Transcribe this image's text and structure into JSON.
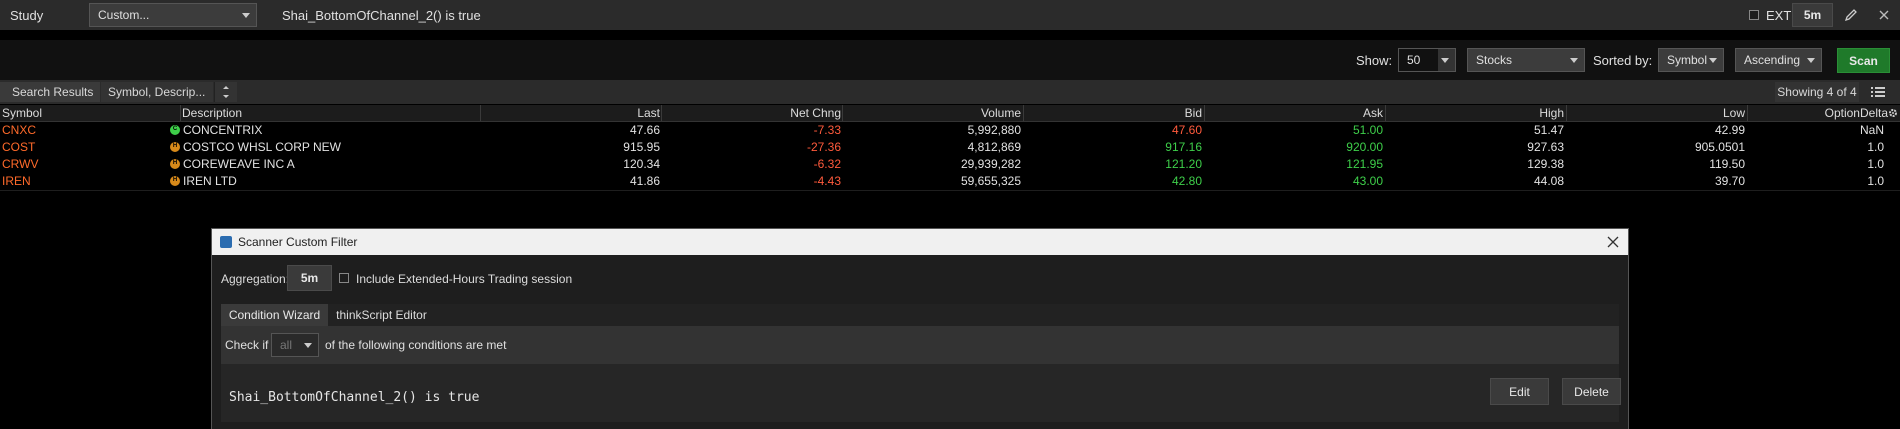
{
  "topbar": {
    "study_label": "Study",
    "study_select": "Custom...",
    "study_condition": "Shai_BottomOfChannel_2() is true",
    "ext_label": "EXT",
    "aggregation": "5m"
  },
  "controls": {
    "show_label": "Show:",
    "show_value": "50",
    "list_value": "Stocks",
    "sorted_label": "Sorted by:",
    "sort_field": "Symbol",
    "sort_order": "Ascending",
    "scan_label": "Scan"
  },
  "results": {
    "tab_label": "Search Results",
    "columns_selector": "Symbol, Descrip...",
    "showing_text": "Showing 4 of 4"
  },
  "table": {
    "headers": [
      "Symbol",
      "Description",
      "Last",
      "Net Chng",
      "Volume",
      "Bid",
      "Ask",
      "High",
      "Low",
      "OptionDelta"
    ],
    "rows": [
      {
        "symbol": "CNXC",
        "badge": "C",
        "description": "CONCENTRIX",
        "last": "47.66",
        "net_chng": "-7.33",
        "volume": "5,992,880",
        "bid": "47.60",
        "ask": "51.00",
        "high": "51.47",
        "low": "42.99",
        "delta": "NaN",
        "bid_color": "red",
        "ask_color": "grn"
      },
      {
        "symbol": "COST",
        "badge": "H",
        "description": "COSTCO WHSL CORP NEW",
        "last": "915.95",
        "net_chng": "-27.36",
        "volume": "4,812,869",
        "bid": "917.16",
        "ask": "920.00",
        "high": "927.63",
        "low": "905.0501",
        "delta": "1.0",
        "bid_color": "grn",
        "ask_color": "grn"
      },
      {
        "symbol": "CRWV",
        "badge": "H",
        "description": "COREWEAVE INC A",
        "last": "120.34",
        "net_chng": "-6.32",
        "volume": "29,939,282",
        "bid": "121.20",
        "ask": "121.95",
        "high": "129.38",
        "low": "119.50",
        "delta": "1.0",
        "bid_color": "grn",
        "ask_color": "grn"
      },
      {
        "symbol": "IREN",
        "badge": "H",
        "description": "IREN LTD",
        "last": "41.86",
        "net_chng": "-4.43",
        "volume": "59,655,325",
        "bid": "42.80",
        "ask": "43.00",
        "high": "44.08",
        "low": "39.70",
        "delta": "1.0",
        "bid_color": "grn",
        "ask_color": "grn"
      }
    ]
  },
  "dialog": {
    "title": "Scanner Custom Filter",
    "aggregation_label": "Aggregation:",
    "aggregation_value": "5m",
    "extended_hours_label": "Include Extended-Hours Trading session",
    "tabs": [
      "Condition Wizard",
      "thinkScript Editor"
    ],
    "check_if_label": "Check if",
    "match_value": "all",
    "conditions_suffix": "of the following conditions are met",
    "condition_text": "Shai_BottomOfChannel_2() is true",
    "edit_label": "Edit",
    "delete_label": "Delete"
  },
  "colors": {
    "negative": "#ff5a3c",
    "positive": "#3ecf4a",
    "symbol": "#ff6a2a",
    "scan_button": "#1f7a2a",
    "badge_green": "#3ecf4a",
    "badge_orange": "#d88a1a"
  }
}
